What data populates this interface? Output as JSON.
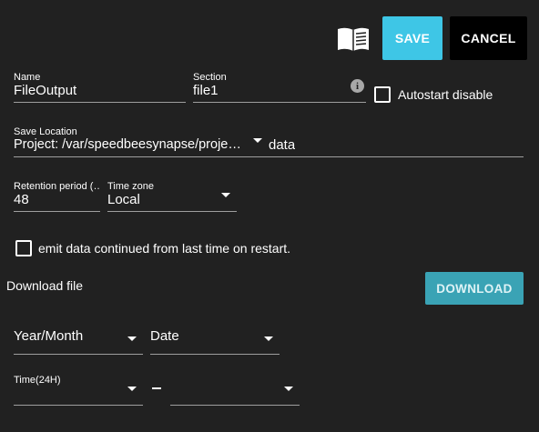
{
  "toolbar": {
    "manual_icon": "book-icon",
    "save_label": "SAVE",
    "cancel_label": "CANCEL"
  },
  "form": {
    "name": {
      "label": "Name",
      "value": "FileOutput"
    },
    "section": {
      "label": "Section",
      "value": "file1",
      "info_icon": "info-icon"
    },
    "autostart": {
      "label": "Autostart disable",
      "checked": false
    },
    "save_location": {
      "label": "Save Location",
      "value": "Project: /var/speedbeesynapse/proje…",
      "subfolder": "data"
    },
    "retention": {
      "label": "Retention period (…",
      "value": "48"
    },
    "timezone": {
      "label": "Time zone",
      "value": "Local"
    },
    "emit_continued": {
      "label": "emit data continued from last time on restart.",
      "checked": false
    }
  },
  "download": {
    "title": "Download file",
    "button_label": "DOWNLOAD",
    "year_month": {
      "value": "Year/Month"
    },
    "date": {
      "value": "Date"
    },
    "time": {
      "label": "Time(24H)",
      "from": "",
      "to": ""
    }
  },
  "colors": {
    "background": "#212121",
    "save": "#3ec6e6",
    "cancel": "#000000",
    "download": "#3aa3b5"
  }
}
